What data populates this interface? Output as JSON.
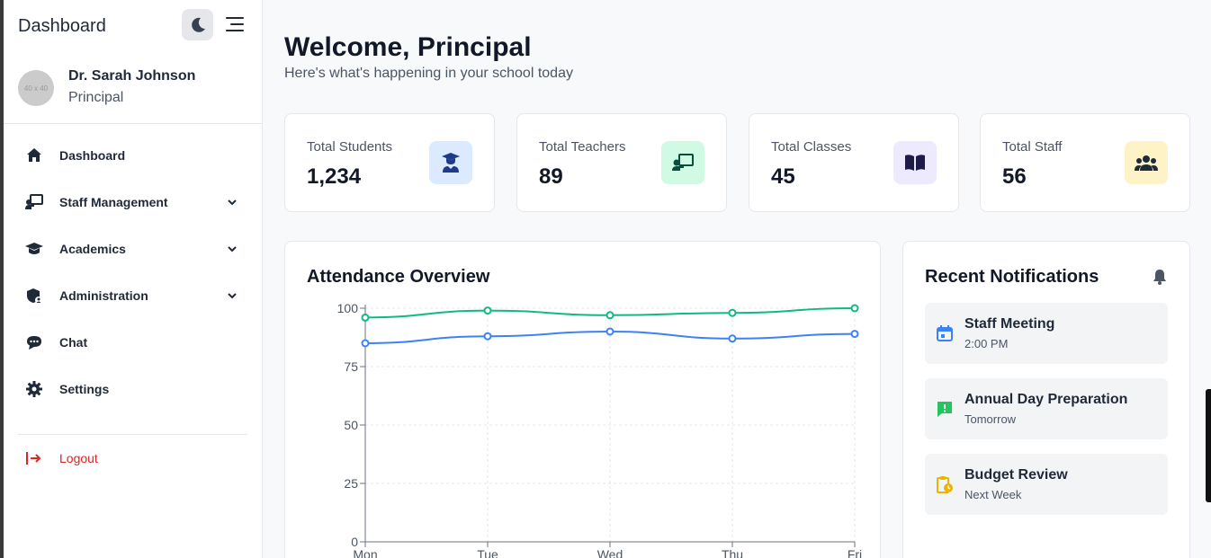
{
  "sidebar": {
    "title": "Dashboard",
    "user": {
      "avatar_text": "40 x 40",
      "name": "Dr. Sarah Johnson",
      "role": "Principal"
    },
    "nav": [
      {
        "label": "Dashboard",
        "icon": "home-icon"
      },
      {
        "label": "Staff Management",
        "icon": "chalkboard-teacher-icon",
        "has_chevron": true
      },
      {
        "label": "Academics",
        "icon": "graduation-cap-icon",
        "has_chevron": true
      },
      {
        "label": "Administration",
        "icon": "shield-user-icon",
        "has_chevron": true
      },
      {
        "label": "Chat",
        "icon": "chat-icon"
      },
      {
        "label": "Settings",
        "icon": "gear-icon"
      }
    ],
    "logout_label": "Logout"
  },
  "header": {
    "welcome": "Welcome, Principal",
    "subtitle": "Here's what's happening in your school today"
  },
  "stats": [
    {
      "label": "Total Students",
      "value": "1,234",
      "icon": "user-graduate-icon",
      "bg": "#dbeafe",
      "fg": "#1e3a8a"
    },
    {
      "label": "Total Teachers",
      "value": "89",
      "icon": "chalkboard-teacher-icon",
      "bg": "#d1fae5",
      "fg": "#064e3b"
    },
    {
      "label": "Total Classes",
      "value": "45",
      "icon": "book-icon",
      "bg": "#ede9fe",
      "fg": "#1e1b4b"
    },
    {
      "label": "Total Staff",
      "value": "56",
      "icon": "users-icon",
      "bg": "#fef3c7",
      "fg": "#1f2937"
    }
  ],
  "attendance": {
    "title": "Attendance Overview"
  },
  "chart_data": {
    "type": "line",
    "title": "Attendance Overview",
    "categories": [
      "Mon",
      "Tue",
      "Wed",
      "Thu",
      "Fri"
    ],
    "series": [
      {
        "values": [
          96,
          99,
          97,
          98,
          100
        ],
        "color": "#10b981"
      },
      {
        "values": [
          85,
          88,
          90,
          87,
          89
        ],
        "color": "#3b82f6"
      }
    ],
    "ylim": [
      0,
      100
    ],
    "yticks": [
      0,
      25,
      50,
      75,
      100
    ],
    "grid": true
  },
  "notifications": {
    "title": "Recent Notifications",
    "items": [
      {
        "title": "Staff Meeting",
        "time": "2:00 PM",
        "icon": "calendar-icon",
        "color": "#3b82f6"
      },
      {
        "title": "Annual Day Preparation",
        "time": "Tomorrow",
        "icon": "alert-message-icon",
        "color": "#22c55e"
      },
      {
        "title": "Budget Review",
        "time": "Next Week",
        "icon": "clipboard-clock-icon",
        "color": "#eab308"
      }
    ]
  }
}
